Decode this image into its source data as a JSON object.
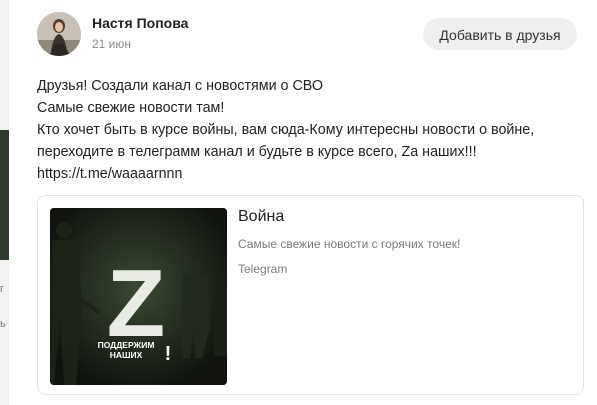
{
  "author": {
    "name": "Настя Попова",
    "date": "21 июн"
  },
  "actions": {
    "add_friend_label": "Добавить в друзья"
  },
  "post": {
    "lines": [
      "Друзья! Создали канал с новостями о СВО",
      "Самые свежие новости там!",
      "Кто хочет быть в курсе войны, вам сюда-Кому интересны новости о войне,",
      "переходите в телеграмм канал и будьте в курсе всего, Zа наших!!!",
      "https://t.me/waaaarnnn"
    ]
  },
  "link_card": {
    "title": "Война",
    "description": "Самые свежие новости с горячих точек!",
    "source": "Telegram",
    "image_text": {
      "letter": "Z",
      "line1": "ПОДДЕРЖИМ",
      "line2": "НАШИХ",
      "exclaim": "!"
    }
  },
  "left_edge_marks": [
    "г",
    "ь"
  ],
  "colors": {
    "button_bg": "#f0efee",
    "text_primary": "#222222",
    "text_secondary": "#8a8a8a",
    "card_border": "#e3e3e3"
  }
}
